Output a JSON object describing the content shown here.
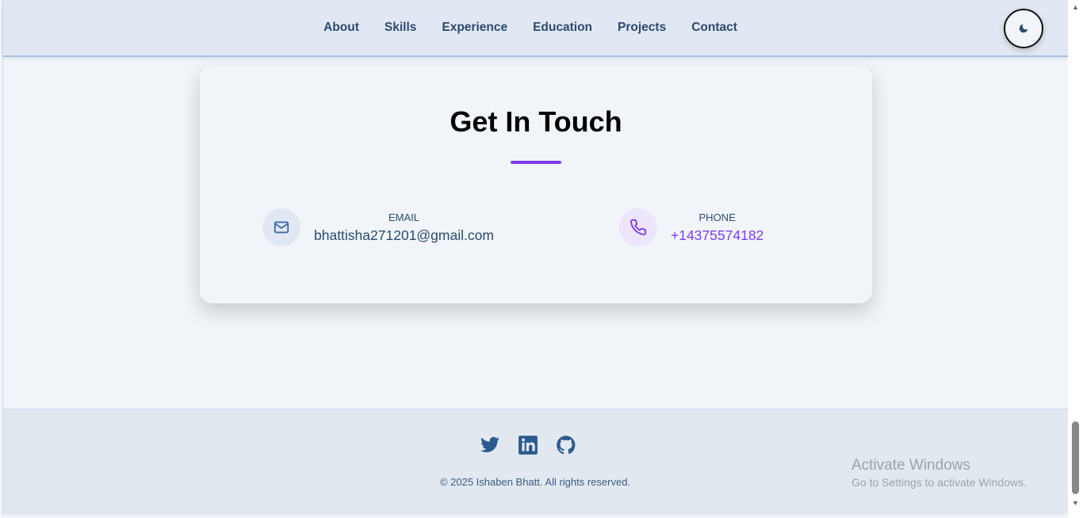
{
  "nav": {
    "links": [
      "About",
      "Skills",
      "Experience",
      "Education",
      "Projects",
      "Contact"
    ],
    "theme_icon": "moon-icon"
  },
  "contact": {
    "title": "Get In Touch",
    "email": {
      "label": "EMAIL",
      "value": "bhattisha271201@gmail.com"
    },
    "phone": {
      "label": "PHONE",
      "value": "+14375574182"
    }
  },
  "footer": {
    "icons": [
      "twitter-icon",
      "linkedin-icon",
      "github-icon"
    ],
    "copyright": "© 2025 Ishaben Bhatt. All rights reserved."
  },
  "watermark": {
    "title": "Activate Windows",
    "subtitle": "Go to Settings to activate Windows."
  },
  "colors": {
    "accent": "#7c3aed",
    "text": "#2b4a6e"
  }
}
